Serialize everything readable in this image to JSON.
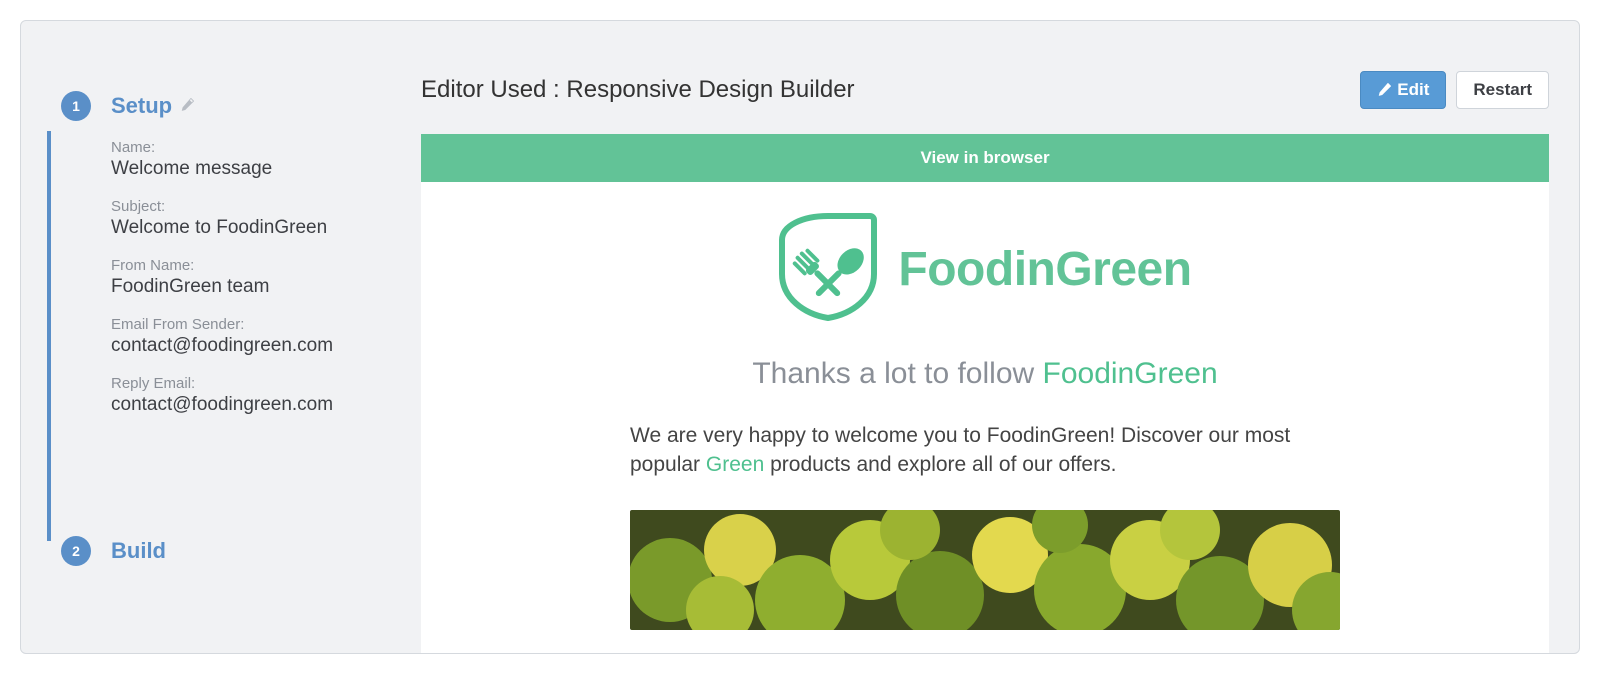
{
  "sidebar": {
    "steps": {
      "setup": {
        "num": "1",
        "title": "Setup"
      },
      "build": {
        "num": "2",
        "title": "Build"
      }
    },
    "fields": {
      "name": {
        "label": "Name:",
        "value": "Welcome message"
      },
      "subject": {
        "label": "Subject:",
        "value": "Welcome to FoodinGreen"
      },
      "from_name": {
        "label": "From Name:",
        "value": "FoodinGreen team"
      },
      "from_email": {
        "label": "Email From Sender:",
        "value": "contact@foodingreen.com"
      },
      "reply_email": {
        "label": "Reply Email:",
        "value": "contact@foodingreen.com"
      }
    }
  },
  "main": {
    "editor_label": "Editor Used : Responsive Design Builder",
    "edit_btn": "Edit",
    "restart_btn": "Restart"
  },
  "preview": {
    "view_in_browser": "View in browser",
    "brand": "FoodinGreen",
    "headline_pre": "Thanks a lot to follow ",
    "headline_accent": "FoodinGreen",
    "body_1": "We are very happy to welcome you to FoodinGreen! Discover our most popular ",
    "body_accent": "Green",
    "body_2": " products and explore all of our offers."
  },
  "colors": {
    "brand_green": "#62c397",
    "step_blue": "#5a8fc8",
    "btn_blue": "#589bd6"
  }
}
